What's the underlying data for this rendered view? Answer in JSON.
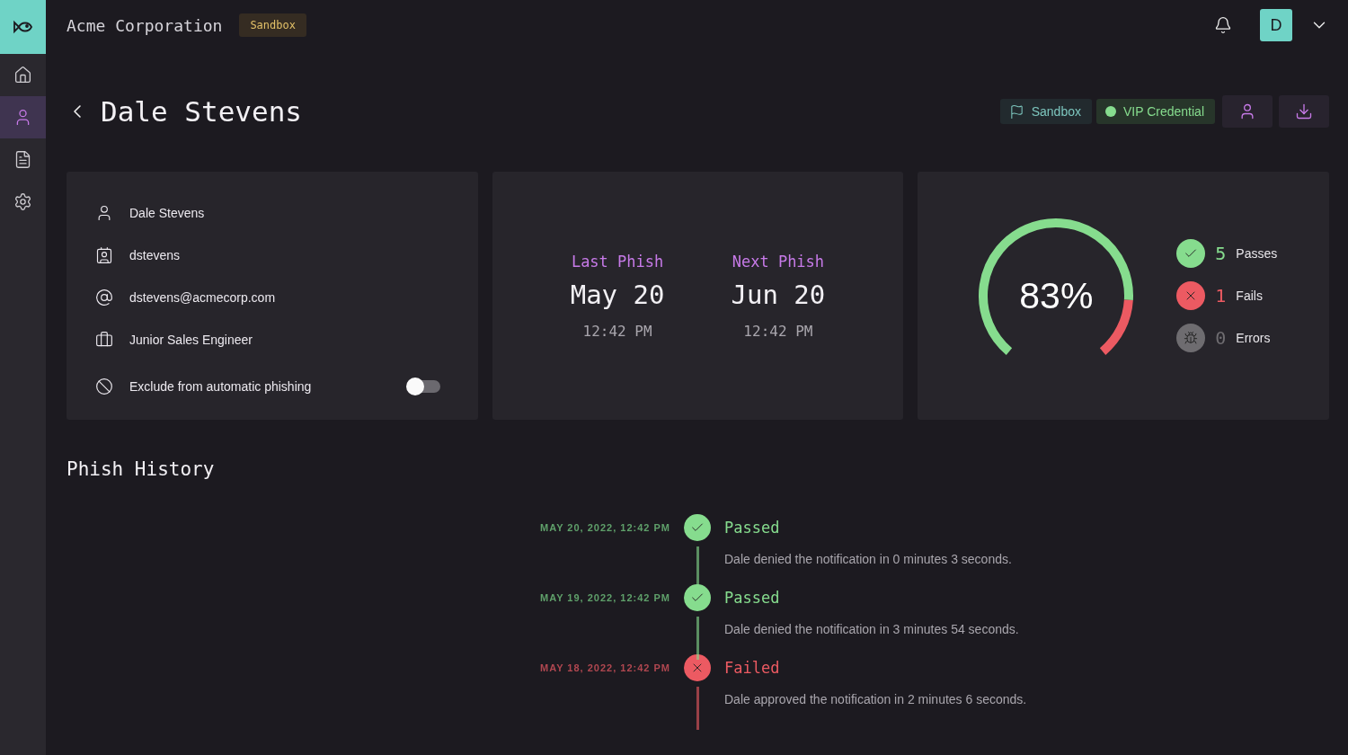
{
  "sidebar": {
    "items": [
      {
        "kind": "home",
        "selected": false
      },
      {
        "kind": "user",
        "selected": true
      },
      {
        "kind": "document",
        "selected": false
      },
      {
        "kind": "settings",
        "selected": false
      }
    ]
  },
  "header": {
    "org": "Acme Corporation",
    "badge": "Sandbox",
    "avatar": "D"
  },
  "page": {
    "title": "Dale Stevens",
    "tags": [
      {
        "kind": "flag",
        "label": "Sandbox"
      },
      {
        "kind": "dot",
        "label": "VIP Credential"
      }
    ]
  },
  "profile": {
    "rows": [
      {
        "kind": "user",
        "text": "Dale Stevens"
      },
      {
        "kind": "badge",
        "text": "dstevens"
      },
      {
        "kind": "at",
        "text": "dstevens@acmecorp.com"
      },
      {
        "kind": "briefcase",
        "text": "Junior Sales Engineer"
      }
    ],
    "exclude": {
      "label": "Exclude from automatic phishing",
      "on": false
    }
  },
  "phish_dates": [
    {
      "label": "Last Phish",
      "date": "May 20",
      "time": "12:42 PM"
    },
    {
      "label": "Next Phish",
      "date": "Jun 20",
      "time": "12:42 PM"
    }
  ],
  "score": {
    "text": "83%",
    "stats": [
      {
        "kind": "pass",
        "count": "5",
        "label": "Passes"
      },
      {
        "kind": "fail",
        "count": "1",
        "label": "Fails"
      },
      {
        "kind": "error",
        "count": "0",
        "label": "Errors"
      }
    ]
  },
  "history": {
    "title": "Phish History",
    "items": [
      {
        "kind": "passed",
        "date": "MAY 20, 2022, 12:42 PM",
        "status": "Passed",
        "text": "Dale denied the notification in 0 minutes 3 seconds."
      },
      {
        "kind": "passed",
        "date": "MAY 19, 2022, 12:42 PM",
        "status": "Passed",
        "text": "Dale denied the notification in 3 minutes 54 seconds."
      },
      {
        "kind": "failed",
        "date": "MAY 18, 2022, 12:42 PM",
        "status": "Failed",
        "text": "Dale approved the notification in 2 minutes 6 seconds."
      }
    ]
  }
}
